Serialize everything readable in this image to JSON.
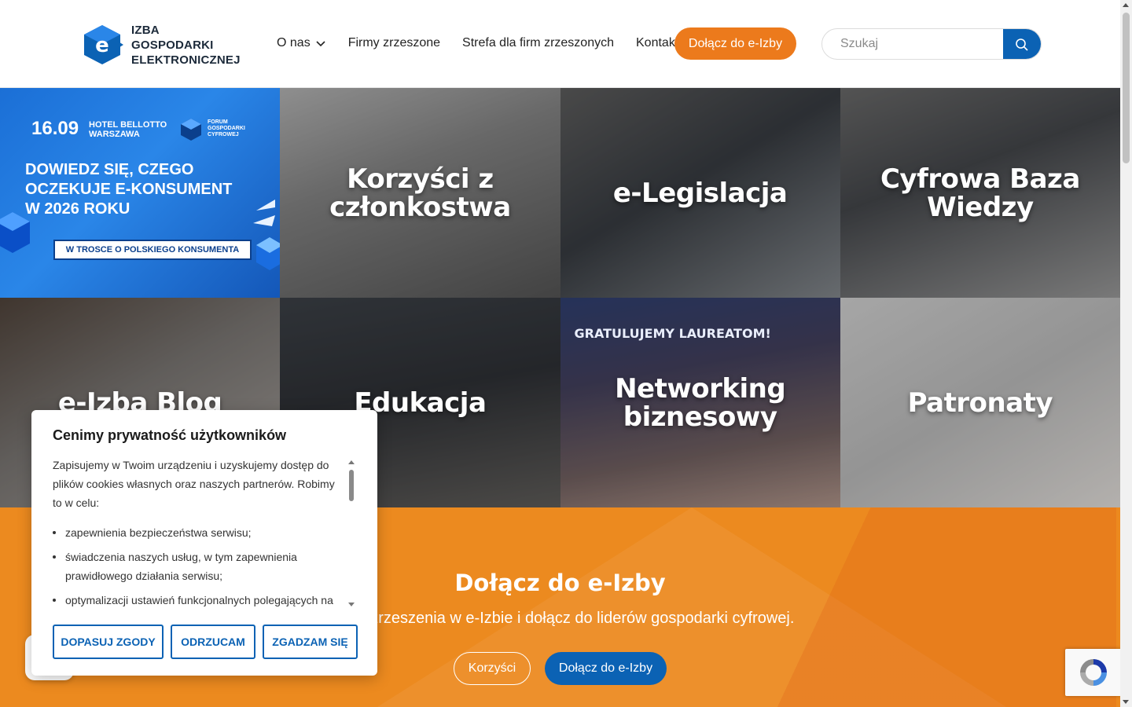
{
  "header": {
    "logo_lines": [
      "IZBA",
      "GOSPODARKI",
      "ELEKTRONICZNEJ"
    ],
    "nav": [
      {
        "label": "O nas",
        "has_dropdown": true
      },
      {
        "label": "Firmy zrzeszone"
      },
      {
        "label": "Strefa dla firm zrzeszonych"
      },
      {
        "label": "Kontakt"
      }
    ],
    "join_label": "Dołącz do e-Izby",
    "search_placeholder": "Szukaj"
  },
  "promo": {
    "date": "16.09",
    "hotel": "HOTEL BELLOTTO WARSZAWA",
    "forum": "FORUM GOSPODARKI CYFROWEJ",
    "headline_1": "DOWIEDZ SIĘ, CZEGO",
    "headline_2": "OCZEKUJE E-KONSUMENT",
    "headline_3": "W 2026 ROKU",
    "tag": "W TROSCE O POLSKIEGO KONSUMENTA"
  },
  "tiles": [
    {
      "label": "Korzyści z członkostwa"
    },
    {
      "label": "e-Legislacja"
    },
    {
      "label": "Cyfrowa Baza Wiedzy"
    },
    {
      "label": "e-Izba Blog"
    },
    {
      "label": "Edukacja"
    },
    {
      "label": "Networking biznesowy"
    },
    {
      "label": "Patronaty"
    }
  ],
  "networking_banner": "GRATULUJEMY LAUREATOM!",
  "cta": {
    "title": "Dołącz do e-Izby",
    "subtitle": "ści ze zrzeszenia w e-Izbie i dołącz do liderów gospodarki cyfrowej.",
    "btn_benefits": "Korzyści",
    "btn_join": "Dołącz do e-Izby"
  },
  "cookie": {
    "title": "Cenimy prywatność użytkowników",
    "intro": "Zapisujemy w Twoim urządzeniu i uzyskujemy dostęp do plików cookies własnych oraz naszych partnerów. Robimy to w celu:",
    "items": [
      "zapewnienia bezpieczeństwa serwisu;",
      "świadczenia naszych usług, w tym zapewnienia prawidłowego działania serwisu;",
      "optymalizacji ustawień funkcjonalnych polegających na"
    ],
    "btn_customize": "DOPASUJ ZGODY",
    "btn_reject": "ODRZUCAM",
    "btn_accept": "ZGADZAM SIĘ"
  },
  "colors": {
    "accent_orange": "#ec7a1c",
    "brand_blue": "#0b62b4"
  }
}
